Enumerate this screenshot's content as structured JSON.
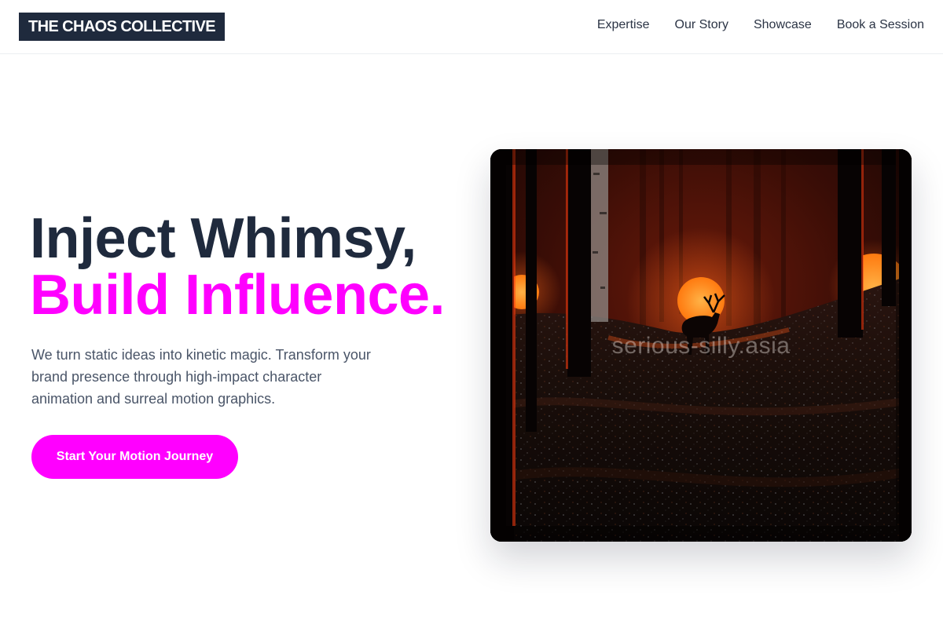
{
  "brand": {
    "logo_text": "THE CHAOS COLLECTIVE"
  },
  "nav": {
    "items": [
      {
        "label": "Expertise"
      },
      {
        "label": "Our Story"
      },
      {
        "label": "Showcase"
      },
      {
        "label": "Book a Session"
      }
    ]
  },
  "hero": {
    "title_line1": "Inject Whimsy,",
    "title_line2": "Build Influence.",
    "subtitle": "We turn static ideas into kinetic magic. Transform your brand presence through high-impact character animation and surreal motion graphics.",
    "cta_label": "Start Your Motion Journey",
    "media": {
      "description_icon": "forest-deer-scene",
      "watermark": "serious-silly.asia"
    }
  },
  "colors": {
    "accent": "#ff00ff",
    "navy": "#1f2a3d",
    "body_text": "#4a5568"
  }
}
